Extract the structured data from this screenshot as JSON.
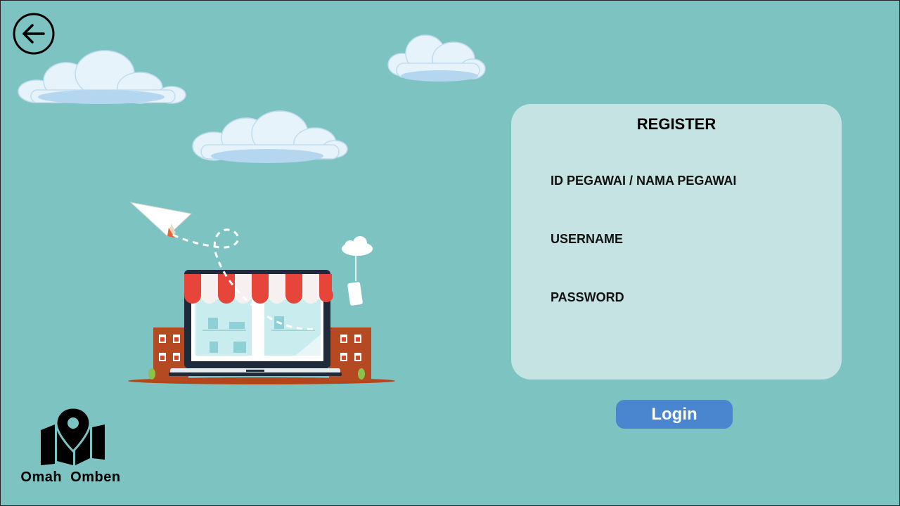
{
  "register": {
    "title": "REGISTER",
    "fields": [
      {
        "label": "ID PEGAWAI / NAMA PEGAWAI"
      },
      {
        "label": "USERNAME"
      },
      {
        "label": "PASSWORD"
      }
    ],
    "login_label": "Login"
  },
  "brand": {
    "name": "Omah  Omben"
  },
  "icons": {
    "back": "arrow-left-icon",
    "logo": "map-pin-icon"
  },
  "colors": {
    "background": "#7cc3c2",
    "card": "#c5e3e2",
    "button": "#4a86d0"
  }
}
